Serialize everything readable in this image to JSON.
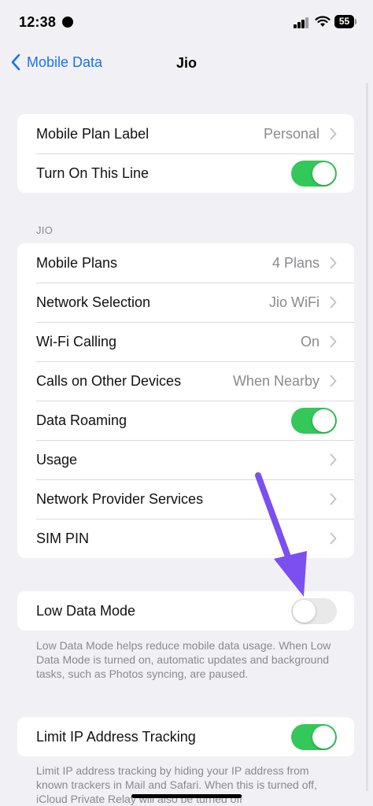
{
  "status_bar": {
    "time": "12:38",
    "battery": "55"
  },
  "nav": {
    "back_label": "Mobile Data",
    "title": "Jio"
  },
  "group1": [
    {
      "label": "Mobile Plan Label",
      "value": "Personal",
      "type": "chevron"
    },
    {
      "label": "Turn On This Line",
      "type": "toggle",
      "on": true
    }
  ],
  "jio_header": "JIO",
  "group2": [
    {
      "label": "Mobile Plans",
      "value": "4 Plans",
      "type": "chevron"
    },
    {
      "label": "Network Selection",
      "value": "Jio WiFi",
      "type": "chevron"
    },
    {
      "label": "Wi-Fi Calling",
      "value": "On",
      "type": "chevron"
    },
    {
      "label": "Calls on Other Devices",
      "value": "When Nearby",
      "type": "chevron"
    },
    {
      "label": "Data Roaming",
      "type": "toggle",
      "on": true
    },
    {
      "label": "Usage",
      "type": "chevron"
    },
    {
      "label": "Network Provider Services",
      "type": "chevron"
    },
    {
      "label": "SIM PIN",
      "type": "chevron"
    }
  ],
  "low_data": {
    "label": "Low Data Mode",
    "on": false,
    "footer": "Low Data Mode helps reduce mobile data usage. When Low Data Mode is turned on, automatic updates and background tasks, such as Photos syncing, are paused."
  },
  "limit_ip": {
    "label": "Limit IP Address Tracking",
    "on": true,
    "footer": "Limit IP address tracking by hiding your IP address from known trackers in Mail and Safari. When this is turned off, iCloud Private Relay will also be turned off"
  },
  "colors": {
    "accent": "#1a73e8",
    "toggle_on": "#34c759",
    "annotation_arrow": "#7b4ff0"
  }
}
